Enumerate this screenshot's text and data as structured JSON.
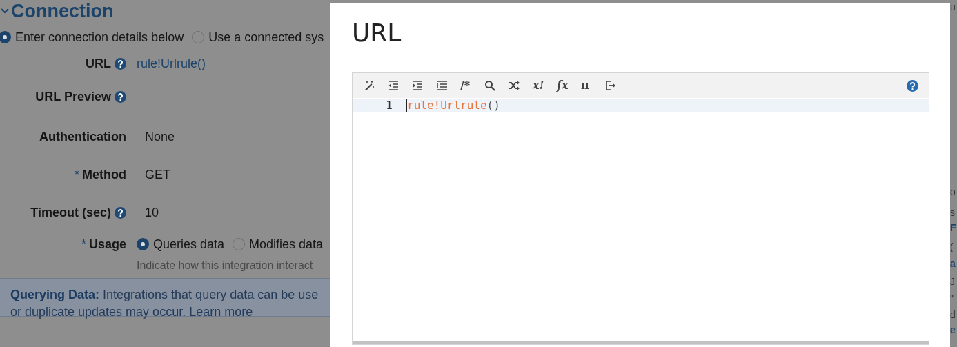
{
  "section": {
    "title": "Connection",
    "expanded": true
  },
  "source_options": [
    {
      "label": "Enter connection details below",
      "selected": true
    },
    {
      "label": "Use a connected sys",
      "selected": false
    }
  ],
  "fields": [
    {
      "kind": "text",
      "label": "URL",
      "help": true,
      "value": "rule!Urlrule()"
    },
    {
      "kind": "text",
      "label": "URL Preview",
      "help": true
    },
    {
      "kind": "input",
      "label": "Authentication",
      "help": false,
      "value": "None"
    },
    {
      "kind": "input",
      "label": "Method",
      "asterisk": "*",
      "help": false,
      "value": "GET"
    },
    {
      "kind": "input",
      "label": "Timeout (sec)",
      "help": true,
      "value": "10"
    },
    {
      "kind": "radio",
      "label": "Usage",
      "asterisk": "*",
      "help": false,
      "options": [
        {
          "label": "Queries data",
          "selected": true
        },
        {
          "label": "Modifies data",
          "selected": false
        }
      ],
      "hint": "Indicate how this integration interact"
    }
  ],
  "info": {
    "line_1": "**Querying Data:** Integrations that query data can be use",
    "line_2": "or duplicate updates may occur.",
    "link": "Learn more"
  },
  "right_fragments": [
    "u",
    "o",
    "s",
    "F",
    "(",
    "a",
    "J",
    "\"",
    "d",
    "e"
  ],
  "dialog": {
    "title": "URL",
    "toolbar": [
      {
        "kind": "magic"
      },
      {
        "kind": "outdent"
      },
      {
        "kind": "indent"
      },
      {
        "kind": "list"
      },
      {
        "kind": "glyph",
        "text": "/*"
      },
      {
        "kind": "search"
      },
      {
        "kind": "shuffle"
      },
      {
        "kind": "glyph",
        "text": "x!",
        "italic": true
      },
      {
        "kind": "glyph",
        "text": "fx",
        "italic": true
      },
      {
        "kind": "glyph",
        "text": "π"
      },
      {
        "kind": "export"
      }
    ],
    "lines": [
      {
        "number": "1",
        "active": true,
        "tokens": [
          {
            "kind": "function",
            "text": "rule!Urlrule"
          },
          {
            "kind": "punct",
            "text": "()"
          }
        ]
      }
    ]
  }
}
